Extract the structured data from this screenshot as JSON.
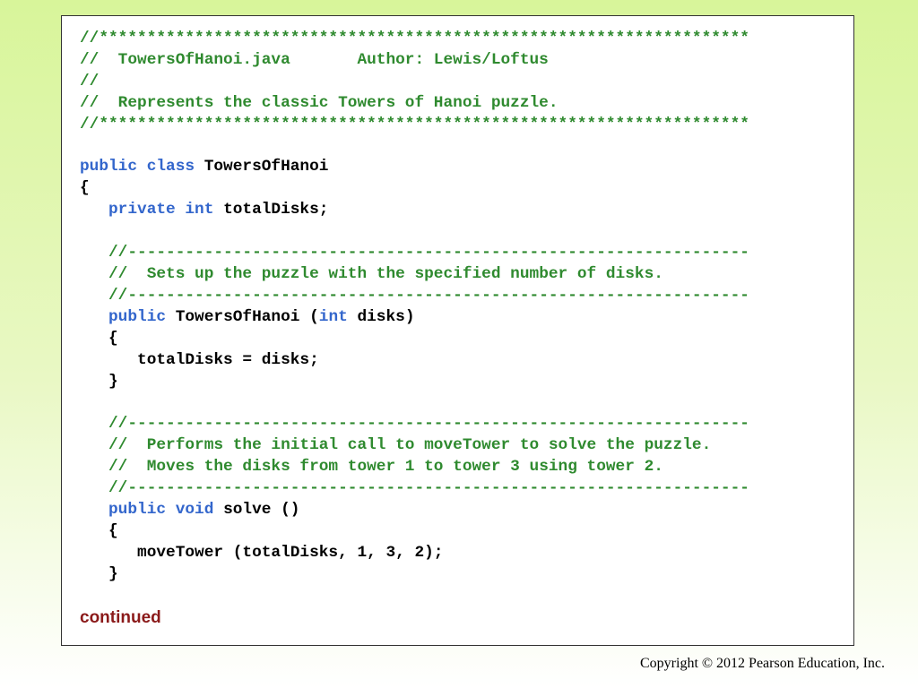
{
  "code_lines": [
    [
      {
        "t": "cm",
        "s": "//********************************************************************"
      }
    ],
    [
      {
        "t": "cm",
        "s": "//  TowersOfHanoi.java       Author: Lewis/Loftus"
      }
    ],
    [
      {
        "t": "cm",
        "s": "//"
      }
    ],
    [
      {
        "t": "cm",
        "s": "//  Represents the classic Towers of Hanoi puzzle."
      }
    ],
    [
      {
        "t": "cm",
        "s": "//********************************************************************"
      }
    ],
    [],
    [
      {
        "t": "kw",
        "s": "public class "
      },
      {
        "t": "tx",
        "s": "TowersOfHanoi"
      }
    ],
    [
      {
        "t": "tx",
        "s": "{"
      }
    ],
    [
      {
        "t": "tx",
        "s": "   "
      },
      {
        "t": "kw",
        "s": "private int "
      },
      {
        "t": "tx",
        "s": "totalDisks;"
      }
    ],
    [],
    [
      {
        "t": "tx",
        "s": "   "
      },
      {
        "t": "cm",
        "s": "//-----------------------------------------------------------------"
      }
    ],
    [
      {
        "t": "tx",
        "s": "   "
      },
      {
        "t": "cm",
        "s": "//  Sets up the puzzle with the specified number of disks."
      }
    ],
    [
      {
        "t": "tx",
        "s": "   "
      },
      {
        "t": "cm",
        "s": "//-----------------------------------------------------------------"
      }
    ],
    [
      {
        "t": "tx",
        "s": "   "
      },
      {
        "t": "kw",
        "s": "public "
      },
      {
        "t": "tx",
        "s": "TowersOfHanoi ("
      },
      {
        "t": "kw",
        "s": "int"
      },
      {
        "t": "tx",
        "s": " disks)"
      }
    ],
    [
      {
        "t": "tx",
        "s": "   {"
      }
    ],
    [
      {
        "t": "tx",
        "s": "      totalDisks = disks;"
      }
    ],
    [
      {
        "t": "tx",
        "s": "   }"
      }
    ],
    [],
    [
      {
        "t": "tx",
        "s": "   "
      },
      {
        "t": "cm",
        "s": "//-----------------------------------------------------------------"
      }
    ],
    [
      {
        "t": "tx",
        "s": "   "
      },
      {
        "t": "cm",
        "s": "//  Performs the initial call to moveTower to solve the puzzle."
      }
    ],
    [
      {
        "t": "tx",
        "s": "   "
      },
      {
        "t": "cm",
        "s": "//  Moves the disks from tower 1 to tower 3 using tower 2."
      }
    ],
    [
      {
        "t": "tx",
        "s": "   "
      },
      {
        "t": "cm",
        "s": "//-----------------------------------------------------------------"
      }
    ],
    [
      {
        "t": "tx",
        "s": "   "
      },
      {
        "t": "kw",
        "s": "public void "
      },
      {
        "t": "tx",
        "s": "solve ()"
      }
    ],
    [
      {
        "t": "tx",
        "s": "   {"
      }
    ],
    [
      {
        "t": "tx",
        "s": "      moveTower (totalDisks, 1, 3, 2);"
      }
    ],
    [
      {
        "t": "tx",
        "s": "   }"
      }
    ]
  ],
  "continued_label": "continued",
  "copyright": "Copyright © 2012 Pearson Education, Inc.",
  "colors": {
    "comment": "#2f8a2f",
    "keyword": "#3366cc",
    "text": "#000000",
    "continued": "#8b1a1a"
  }
}
